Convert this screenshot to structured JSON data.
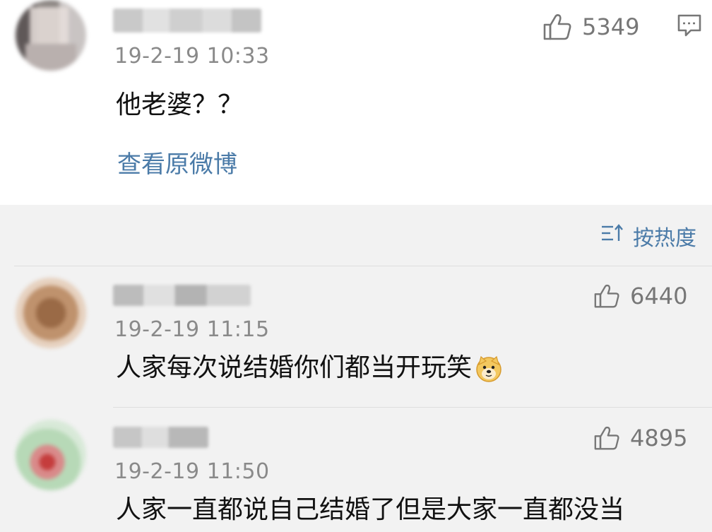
{
  "main_comment": {
    "timestamp": "19-2-19 10:33",
    "text": "他老婆？？",
    "like_count": "5349",
    "view_original_link": "查看原微博",
    "icons": {
      "like": "thumbs-up-icon",
      "reply": "comment-icon"
    }
  },
  "replies": {
    "sort_label": "按热度",
    "sort_icon": "sort-icon",
    "items": [
      {
        "timestamp": "19-2-19 11:15",
        "text": "人家每次说结婚你们都当开玩笑",
        "like_count": "6440",
        "emoji": "doge-emoji"
      },
      {
        "timestamp": "19-2-19 11:50",
        "text": "人家一直都说自己结婚了但是大家一直都没当",
        "like_count": "4895"
      }
    ]
  },
  "colors": {
    "link": "#4b7ba8",
    "timestamp": "#8a8a8a",
    "reply_background": "#f2f2f2",
    "icon": "#777777"
  }
}
